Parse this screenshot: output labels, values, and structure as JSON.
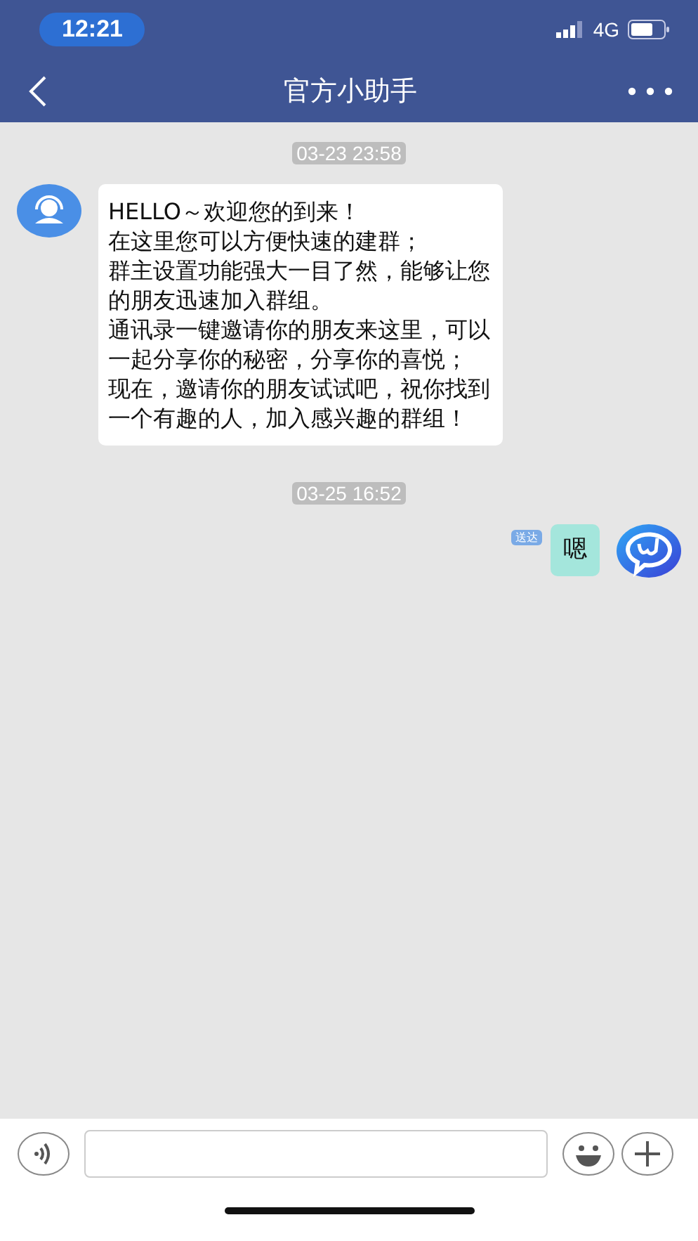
{
  "status_bar": {
    "time": "12:21",
    "network": "4G"
  },
  "nav": {
    "title": "官方小助手"
  },
  "messages": [
    {
      "kind": "time",
      "text": "03-23 23:58"
    },
    {
      "kind": "incoming",
      "lines": [
        "HELLO～欢迎您的到来！",
        "在这里您可以方便快速的建群；",
        "群主设置功能强大一目了然，能够让您",
        "的朋友迅速加入群组。",
        "通讯录一键邀请你的朋友来这里，可以",
        "一起分享你的秘密，分享你的喜悦；",
        "现在，邀请你的朋友试试吧，祝你找到",
        "一个有趣的人，加入感兴趣的群组！"
      ]
    },
    {
      "kind": "time",
      "text": "03-25 16:52"
    },
    {
      "kind": "outgoing",
      "lines": [
        "嗯"
      ],
      "status": "送达"
    }
  ]
}
